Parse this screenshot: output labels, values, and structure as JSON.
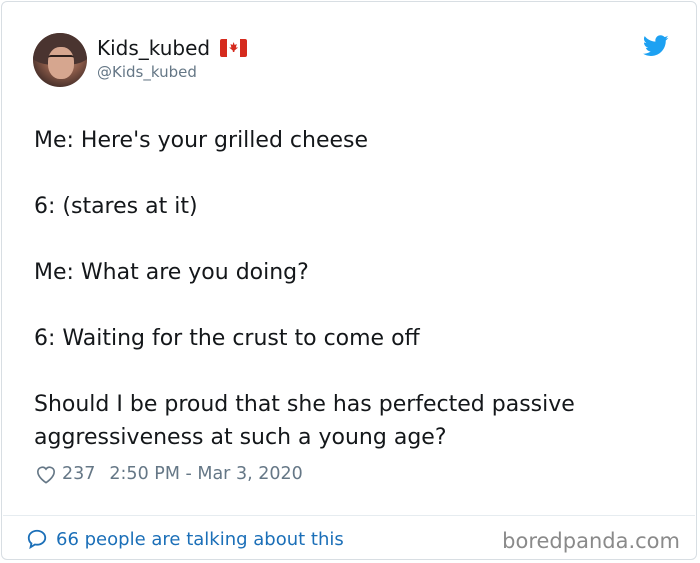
{
  "tweet": {
    "display_name": "Kids_kubed",
    "handle": "@Kids_kubed",
    "lines": [
      "Me: Here's your grilled cheese",
      "6: (stares at it)",
      "Me: What are you doing?",
      "6: Waiting for the crust to come off",
      "Should I be proud that she has perfected passive aggressiveness at such a young age?"
    ],
    "likes": "237",
    "timestamp": "2:50 PM - Mar 3, 2020",
    "talking": "66 people are talking about this"
  },
  "watermark": "boredpanda.com",
  "icons": {
    "avatar": "profile-photo",
    "flag": "canada-flag-icon",
    "brand": "twitter-bird-icon",
    "like": "heart-icon",
    "reply": "speech-bubble-icon"
  },
  "colors": {
    "text": "#14171a",
    "muted": "#657786",
    "twitter_blue": "#1da1f2",
    "link_blue": "#1b6fb8",
    "flag_red": "#d52b1e"
  }
}
